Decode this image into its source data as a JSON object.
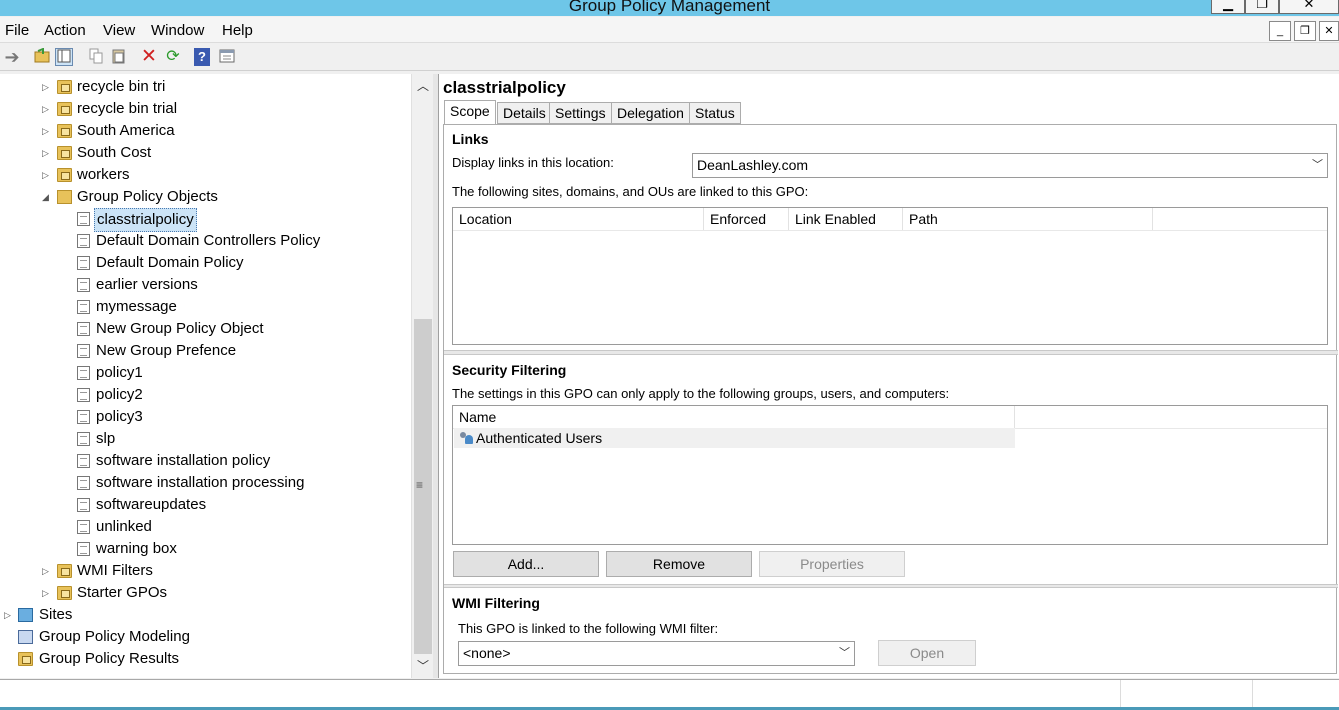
{
  "window": {
    "title": "Group Policy Management",
    "controls": {
      "minimize": "▁",
      "restore": "❐",
      "close": "✕"
    },
    "mdi_controls": {
      "minimize": "_",
      "restore": "❐",
      "close": "✕"
    }
  },
  "menu": [
    "File",
    "Action",
    "View",
    "Window",
    "Help"
  ],
  "toolbar": {
    "icons": [
      "back-arrow-icon",
      "open-folder-icon",
      "show-hide-console-tree-icon",
      "copy-icon",
      "paste-icon",
      "delete-icon",
      "refresh-icon",
      "help-icon",
      "properties-icon"
    ]
  },
  "tree": {
    "items": [
      {
        "label": "recycle bin tri",
        "icon": "folder"
      },
      {
        "label": "recycle bin trial",
        "icon": "folder"
      },
      {
        "label": "South America",
        "icon": "folder"
      },
      {
        "label": "South Cost",
        "icon": "folder"
      },
      {
        "label": "workers",
        "icon": "folder"
      },
      {
        "label": "Group Policy Objects",
        "icon": "gpo-folder",
        "expanded": true
      },
      {
        "label": "classtrialpolicy",
        "icon": "gpo",
        "selected": true
      },
      {
        "label": "Default Domain Controllers Policy",
        "icon": "gpo"
      },
      {
        "label": "Default Domain Policy",
        "icon": "gpo"
      },
      {
        "label": "earlier versions",
        "icon": "gpo"
      },
      {
        "label": "mymessage",
        "icon": "gpo"
      },
      {
        "label": "New Group Policy Object",
        "icon": "gpo"
      },
      {
        "label": "New Group Prefence",
        "icon": "gpo"
      },
      {
        "label": "policy1",
        "icon": "gpo"
      },
      {
        "label": "policy2",
        "icon": "gpo"
      },
      {
        "label": "policy3",
        "icon": "gpo"
      },
      {
        "label": "slp",
        "icon": "gpo"
      },
      {
        "label": "software installation policy",
        "icon": "gpo"
      },
      {
        "label": "software installation processing",
        "icon": "gpo"
      },
      {
        "label": "softwareupdates",
        "icon": "gpo"
      },
      {
        "label": "unlinked",
        "icon": "gpo"
      },
      {
        "label": "warning box",
        "icon": "gpo"
      },
      {
        "label": "WMI Filters",
        "icon": "folder"
      },
      {
        "label": "Starter GPOs",
        "icon": "folder"
      },
      {
        "label": "Sites",
        "icon": "site"
      },
      {
        "label": "Group Policy Modeling",
        "icon": "modeling"
      },
      {
        "label": "Group Policy Results",
        "icon": "results"
      }
    ]
  },
  "details": {
    "gpo_name": "classtrialpolicy",
    "tabs": [
      "Scope",
      "Details",
      "Settings",
      "Delegation",
      "Status"
    ],
    "active_tab": "Scope",
    "links": {
      "heading": "Links",
      "display_label": "Display links in this location:",
      "display_value": "DeanLashley.com",
      "description": "The following sites, domains, and OUs are linked to this GPO:",
      "columns": [
        "Location",
        "Enforced",
        "Link Enabled",
        "Path"
      ],
      "rows": []
    },
    "security": {
      "heading": "Security Filtering",
      "description": "The settings in this GPO can only apply to the following groups, users, and computers:",
      "columns": [
        "Name"
      ],
      "rows": [
        "Authenticated Users"
      ],
      "buttons": {
        "add": "Add...",
        "remove": "Remove",
        "properties": "Properties"
      }
    },
    "wmi": {
      "heading": "WMI Filtering",
      "description": "This GPO is linked to the following WMI filter:",
      "value": "<none>",
      "open_button": "Open"
    }
  }
}
